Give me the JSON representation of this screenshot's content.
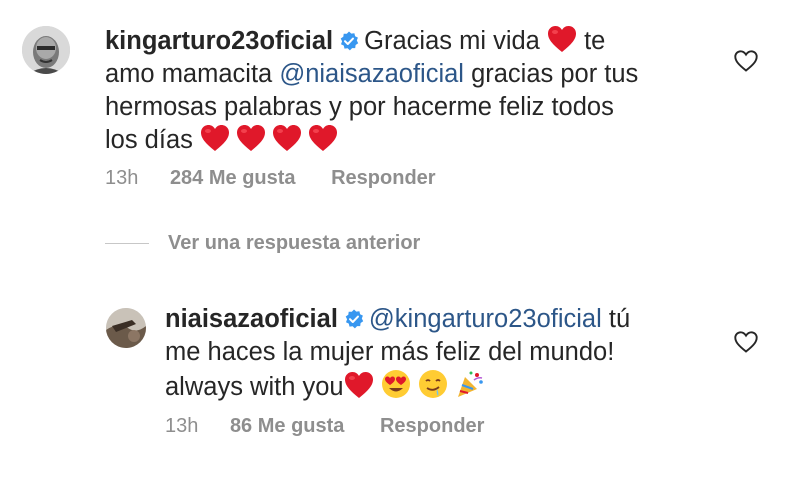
{
  "comment1": {
    "username": "kingarturo23oficial",
    "text1": "Gracias mi vida",
    "text2": "te",
    "text3": "amo mamacita",
    "mention": "@niaisazaoficial",
    "text4": "gracias por tus",
    "line3": "hermosas palabras y por hacerme feliz todos",
    "line4": "los días",
    "time": "13h",
    "likes": "284 Me gusta",
    "reply": "Responder"
  },
  "view_replies": "Ver una respuesta anterior",
  "comment2": {
    "username": "niaisazaoficial",
    "mention": "@kingarturo23oficial",
    "text1": "tú",
    "line2": "me haces la mujer más feliz del mundo!",
    "line3": "always with you",
    "time": "13h",
    "likes": "86 Me gusta",
    "reply": "Responder"
  },
  "colors": {
    "verified": "#3897f0",
    "heart": "#e0182a",
    "mention": "#2c5688",
    "meta": "#8e8e8e"
  },
  "icons": [
    "avatar",
    "verified-badge-icon",
    "red-heart-emoji",
    "heart-eyes-emoji",
    "drooling-face-emoji",
    "party-popper-emoji",
    "like-heart-icon"
  ]
}
